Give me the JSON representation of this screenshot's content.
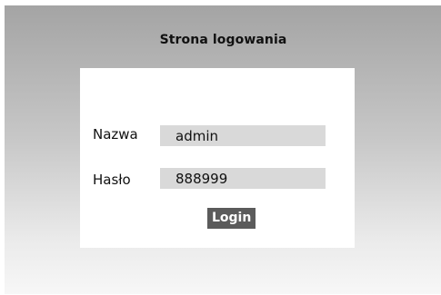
{
  "page": {
    "title": "Strona logowania"
  },
  "form": {
    "username_label": "Nazwa",
    "username_value": "admin",
    "password_label": "Hasło",
    "password_value": "888999",
    "login_label": "Login"
  },
  "colors": {
    "background_top": "#a4a4a4",
    "background_bottom": "#f7f7f7",
    "card": "#ffffff",
    "input": "#d9d9d9",
    "button": "#5b5b5b",
    "button_text": "#ffffff"
  }
}
